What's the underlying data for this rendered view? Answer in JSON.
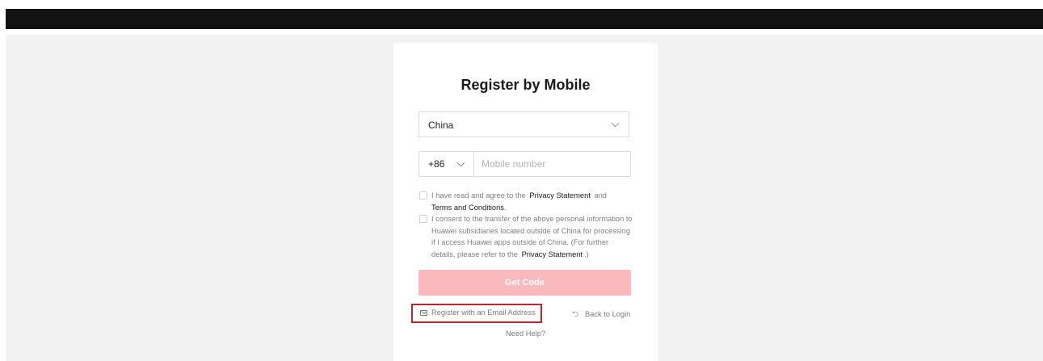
{
  "form": {
    "title": "Register by Mobile",
    "country": {
      "value": "China"
    },
    "phone": {
      "country_code": "+86",
      "placeholder": "Mobile number",
      "value": ""
    },
    "consent1": {
      "text_before": "I have read and agree to the",
      "privacy_link": "Privacy Statement",
      "and_text": "and",
      "terms_link": "Terms and Conditions",
      "end_text": "."
    },
    "consent2": {
      "text": "I consent to the transfer of the above personal information to Huawei subsidiaries located outside of China for processing if I access Huawei apps outside of China. (For further details, please refer to the",
      "privacy_link": "Privacy Statement",
      "end_text": ".)"
    },
    "get_code_label": "Get Code",
    "register_email_label": "Register with an Email Address",
    "back_to_login_label": "Back to Login",
    "need_help_label": "Need Help?"
  },
  "colors": {
    "top_bar": "#121212",
    "page_background": "#f2f2f2",
    "button_disabled": "#f9b9bd",
    "highlight_border": "#c8232c"
  },
  "icons": [
    "chevron-down-icon",
    "mail-icon",
    "back-arrow-icon"
  ]
}
